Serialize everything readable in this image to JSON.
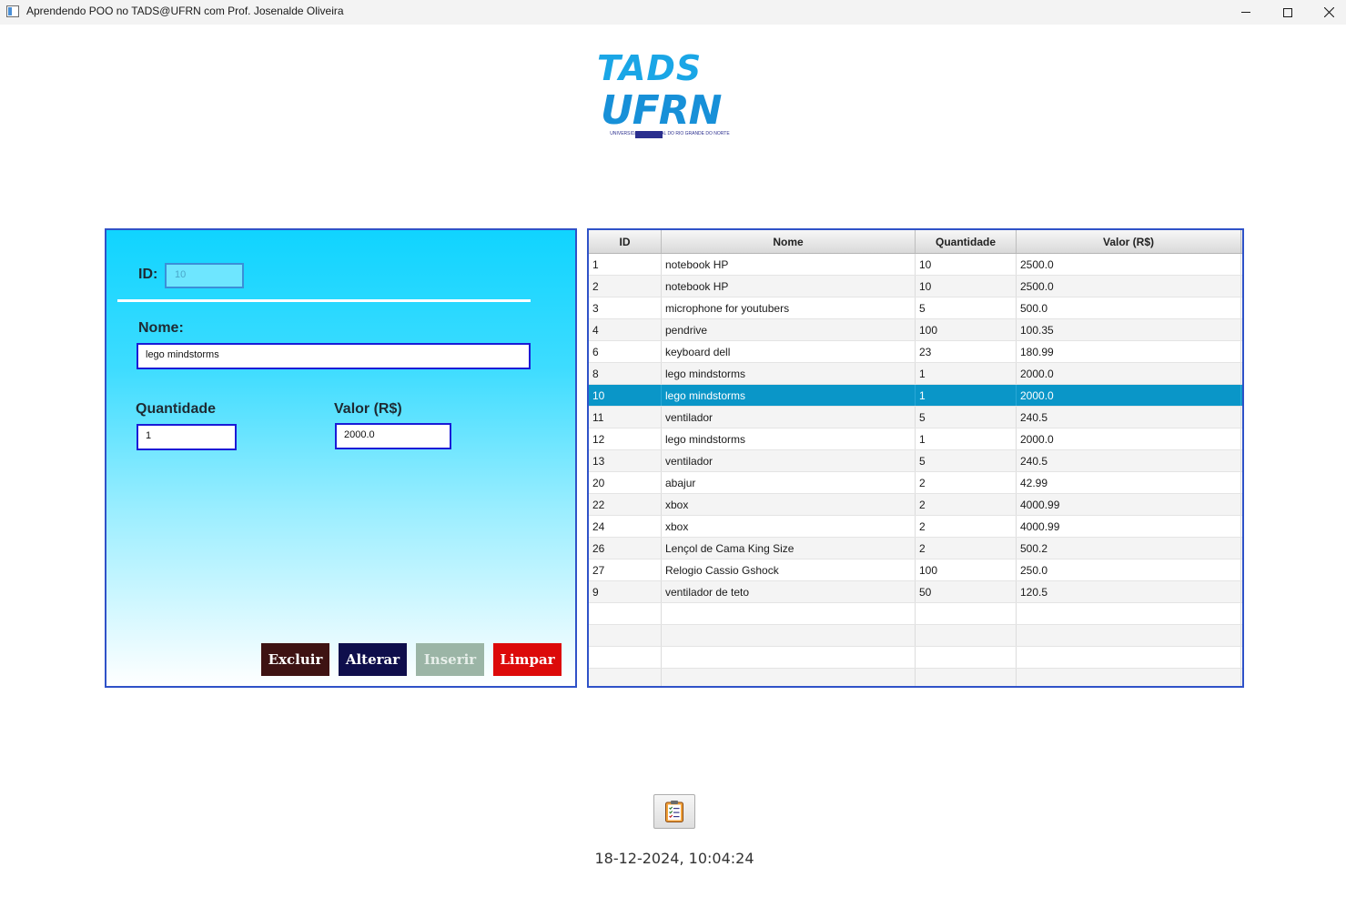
{
  "window": {
    "title": "Aprendendo POO no TADS@UFRN com Prof. Josenalde Oliveira",
    "icon": "app-window-icon",
    "controls": [
      "minimize-icon",
      "maximize-icon",
      "close-icon"
    ]
  },
  "logo": {
    "line1": "TADS",
    "line2": "UFRN",
    "subtitle": "UNIVERSIDADE FEDERAL DO RIO GRANDE DO NORTE"
  },
  "form": {
    "id_label": "ID:",
    "id_value": "10",
    "name_label": "Nome:",
    "name_value": "lego mindstorms",
    "qty_label": "Quantidade",
    "qty_value": "1",
    "price_label": "Valor (R$)",
    "price_value": "2000.0",
    "buttons": {
      "excluir": "Excluir",
      "alterar": "Alterar",
      "inserir": "Inserir",
      "limpar": "Limpar"
    },
    "colors": {
      "excluir": "#3e1313",
      "alterar": "#0e0e4c",
      "inserir": "#9bb5a6",
      "limpar": "#dc0a0a",
      "panel_border": "#2f52c8",
      "selected_row": "#0a96c8"
    }
  },
  "table": {
    "headers": [
      "ID",
      "Nome",
      "Quantidade",
      "Valor (R$)"
    ],
    "rows": [
      [
        "1",
        "notebook HP",
        "10",
        "2500.0"
      ],
      [
        "2",
        "notebook HP",
        "10",
        "2500.0"
      ],
      [
        "3",
        "microphone for youtubers",
        "5",
        "500.0"
      ],
      [
        "4",
        "pendrive",
        "100",
        "100.35"
      ],
      [
        "6",
        "keyboard dell",
        "23",
        "180.99"
      ],
      [
        "8",
        "lego mindstorms",
        "1",
        "2000.0"
      ],
      [
        "10",
        "lego mindstorms",
        "1",
        "2000.0"
      ],
      [
        "11",
        "ventilador",
        "5",
        "240.5"
      ],
      [
        "12",
        "lego mindstorms",
        "1",
        "2000.0"
      ],
      [
        "13",
        "ventilador",
        "5",
        "240.5"
      ],
      [
        "20",
        "abajur",
        "2",
        "42.99"
      ],
      [
        "22",
        "xbox",
        "2",
        "4000.99"
      ],
      [
        "24",
        "xbox",
        "2",
        "4000.99"
      ],
      [
        "26",
        "Lençol de Cama King Size",
        "2",
        "500.2"
      ],
      [
        "27",
        "Relogio Cassio Gshock",
        "100",
        "250.0"
      ],
      [
        "9",
        "ventilador de teto",
        "50",
        "120.5"
      ]
    ],
    "selected_index": 6,
    "empty_rows": 4
  },
  "footer": {
    "report_icon": "clipboard-checklist-icon",
    "datetime": "18-12-2024, 10:04:24"
  }
}
